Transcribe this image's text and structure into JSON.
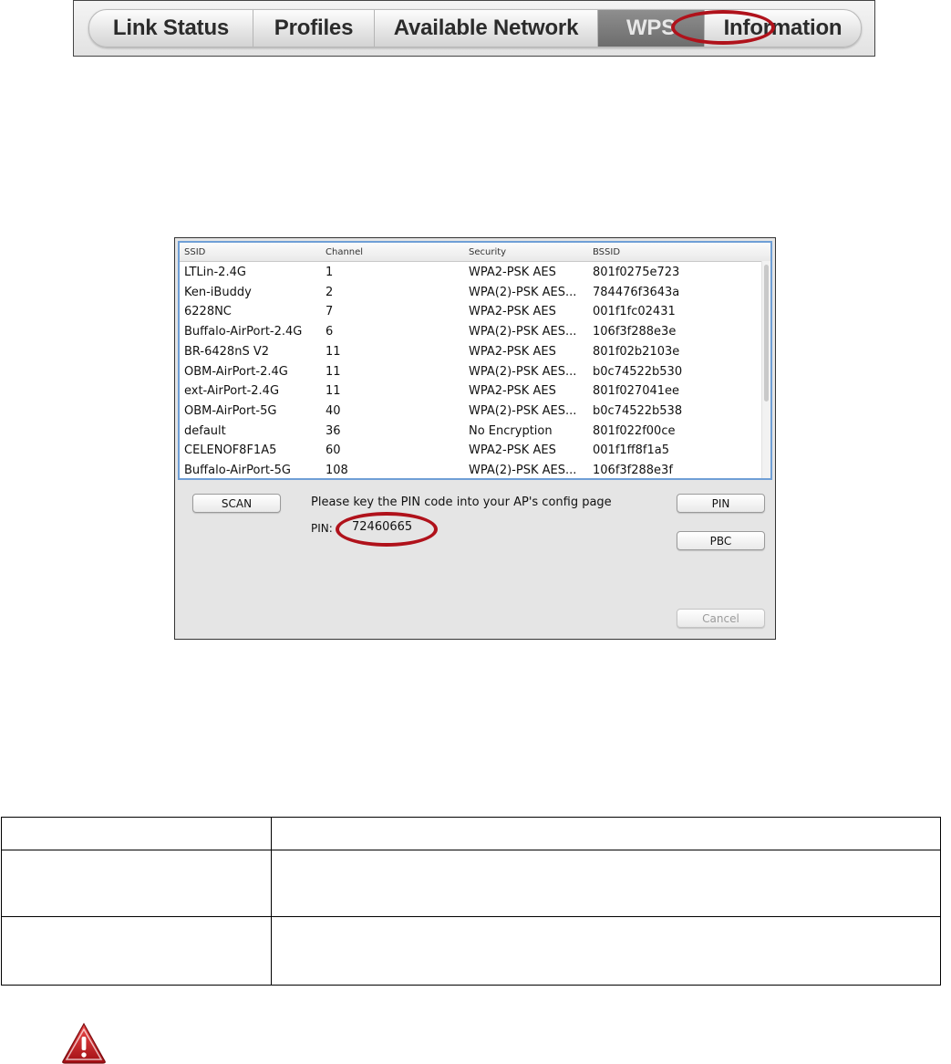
{
  "tabs": [
    {
      "label": "Link Status"
    },
    {
      "label": "Profiles"
    },
    {
      "label": "Available Network"
    },
    {
      "label": "WPS",
      "active": true
    },
    {
      "label": "Information"
    }
  ],
  "wps": {
    "columns": [
      "SSID",
      "Channel",
      "Security",
      "BSSID"
    ],
    "networks": [
      {
        "ssid": "LTLin-2.4G",
        "channel": "1",
        "security": "WPA2-PSK AES",
        "bssid": "801f0275e723"
      },
      {
        "ssid": "Ken-iBuddy",
        "channel": "2",
        "security": "WPA(2)-PSK AES...",
        "bssid": "784476f3643a"
      },
      {
        "ssid": "6228NC",
        "channel": "7",
        "security": "WPA2-PSK AES",
        "bssid": "001f1fc02431"
      },
      {
        "ssid": "Buffalo-AirPort-2.4G",
        "channel": "6",
        "security": "WPA(2)-PSK AES...",
        "bssid": "106f3f288e3e"
      },
      {
        "ssid": "BR-6428nS V2",
        "channel": "11",
        "security": "WPA2-PSK AES",
        "bssid": "801f02b2103e"
      },
      {
        "ssid": "OBM-AirPort-2.4G",
        "channel": "11",
        "security": "WPA(2)-PSK AES...",
        "bssid": "b0c74522b530"
      },
      {
        "ssid": "ext-AirPort-2.4G",
        "channel": "11",
        "security": "WPA2-PSK AES",
        "bssid": "801f027041ee"
      },
      {
        "ssid": "OBM-AirPort-5G",
        "channel": "40",
        "security": "WPA(2)-PSK AES...",
        "bssid": "b0c74522b538"
      },
      {
        "ssid": "default",
        "channel": "36",
        "security": "No Encryption",
        "bssid": "801f022f00ce"
      },
      {
        "ssid": "CELENOF8F1A5",
        "channel": "60",
        "security": "WPA2-PSK AES",
        "bssid": "001f1ff8f1a5"
      },
      {
        "ssid": "Buffalo-AirPort-5G",
        "channel": "108",
        "security": "WPA(2)-PSK AES...",
        "bssid": "106f3f288e3f"
      }
    ],
    "scan_label": "SCAN",
    "message": "Please key the PIN code into your AP's config page",
    "pin_label": "PIN:",
    "pin_value": "72460665",
    "pin_button": "PIN",
    "pbc_button": "PBC",
    "cancel_button": "Cancel"
  },
  "highlight_color": "#b0121b",
  "warning_icon": "warning-triangle-icon"
}
